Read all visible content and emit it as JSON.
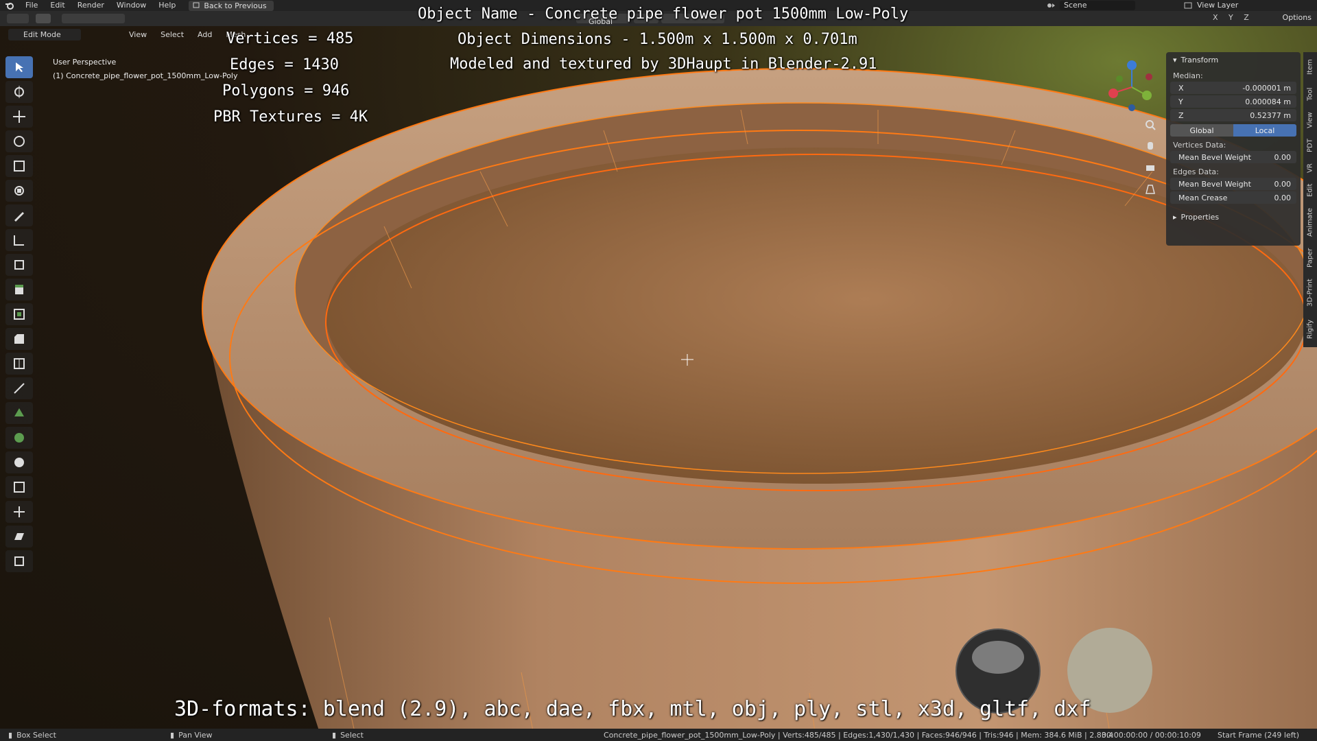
{
  "menu": {
    "items": [
      "File",
      "Edit",
      "Render",
      "Window",
      "Help"
    ],
    "back_button": "Back to Previous",
    "scene_label": "Scene",
    "view_layer_label": "View Layer"
  },
  "header": {
    "transform_orientation": "Global",
    "options_label": "Options",
    "axis_labels": "X Y Z"
  },
  "viewport_header": {
    "mode": "Edit Mode",
    "menus": [
      "View",
      "Select",
      "Add",
      "Mesh"
    ]
  },
  "viewport": {
    "perspective": "User Perspective",
    "object": "(1) Concrete_pipe_flower_pot_1500mm_Low-Poly"
  },
  "overlay": {
    "vertices": "Vertices = 485",
    "edges": "Edges = 1430",
    "polygons": "Polygons = 946",
    "textures": "PBR Textures = 4K",
    "object_name": "Object Name - Concrete pipe flower pot 1500mm Low-Poly",
    "dimensions": "Object Dimensions -  1.500m x 1.500m x 0.701m",
    "credit": "Modeled and textured by 3DHaupt in Blender-2.91",
    "formats": "3D-formats: blend (2.9), abc, dae, fbx, mtl, obj, ply, stl, x3d, gltf, dxf"
  },
  "npanel": {
    "title": "Transform",
    "median_label": "Median:",
    "x_label": "X",
    "x_value": "-0.000001 m",
    "y_label": "Y",
    "y_value": "0.000084 m",
    "z_label": "Z",
    "z_value": "0.52377 m",
    "global_label": "Global",
    "local_label": "Local",
    "vertices_data": "Vertices Data:",
    "mean_bevel_label": "Mean Bevel Weight",
    "vert_bevel_value": "0.00",
    "edges_data": "Edges Data:",
    "edge_bevel_value": "0.00",
    "mean_crease_label": "Mean Crease",
    "crease_value": "0.00",
    "properties_label": "Properties"
  },
  "sidetabs": [
    "Item",
    "Tool",
    "View",
    "PDT",
    "VR",
    "Edit",
    "Animate",
    "Paper",
    "3D-Print",
    "Rigify"
  ],
  "status": {
    "box_select": "Box Select",
    "pan_view": "Pan View",
    "select": "Select",
    "stats": "Concrete_pipe_flower_pot_1500mm_Low-Poly | Verts:485/485 | Edges:1,430/1,430 | Faces:946/946 | Tris:946 | Mem: 384.6 MiB | 2.83.4",
    "time": "00:00:00:00 / 00:00:10:09",
    "frame": "Start Frame (249 left)"
  },
  "colors": {
    "accent": "#4772b3",
    "wire": "#ff8a1c",
    "pot": "#b98a62"
  }
}
